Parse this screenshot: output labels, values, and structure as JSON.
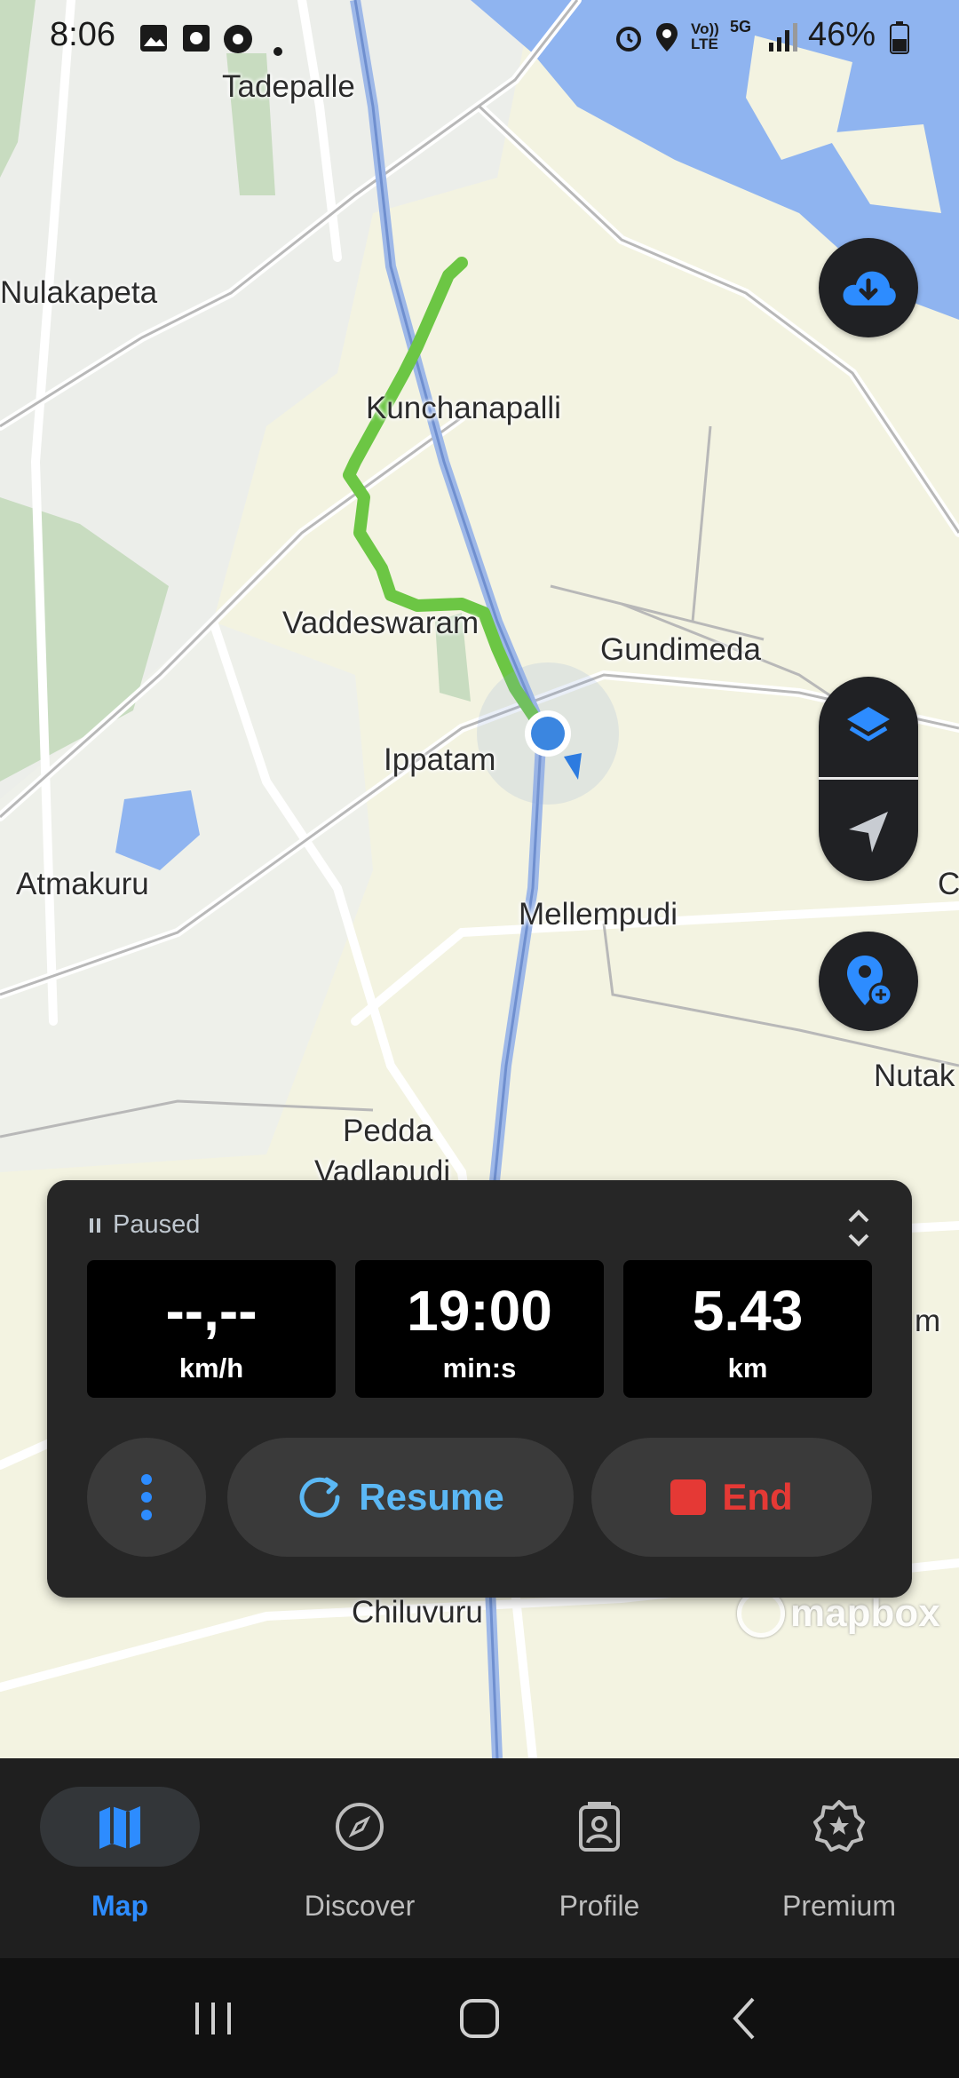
{
  "status_bar": {
    "time": "8:06",
    "battery": "46%",
    "icons": [
      "gallery-icon",
      "photo-icon",
      "chrome-icon",
      "dot-icon",
      "alarm-icon",
      "location-icon",
      "volte-icon",
      "5g-icon",
      "signal-icon",
      "battery-icon"
    ]
  },
  "map": {
    "places": [
      "Tadepalle",
      "Nulakapeta",
      "Kunchanapalli",
      "Vaddeswaram",
      "Gundimeda",
      "Ippatam",
      "Atmakuru",
      "Mellempudi",
      "Nutak",
      "C",
      "Pedda",
      "Vadlapudi",
      "Chiluvuru",
      "m"
    ],
    "attribution": "mapbox",
    "route_color": "#6cc644",
    "water_color": "#8fb4f0"
  },
  "panel": {
    "status": "Paused",
    "stats": [
      {
        "value": "--,--",
        "unit": "km/h"
      },
      {
        "value": "19:00",
        "unit": "min:s"
      },
      {
        "value": "5.43",
        "unit": "km"
      }
    ],
    "resume_label": "Resume",
    "end_label": "End"
  },
  "bottom_nav": {
    "items": [
      {
        "label": "Map",
        "icon": "map-icon",
        "active": true
      },
      {
        "label": "Discover",
        "icon": "compass-icon",
        "active": false
      },
      {
        "label": "Profile",
        "icon": "profile-icon",
        "active": false
      },
      {
        "label": "Premium",
        "icon": "premium-badge-icon",
        "active": false
      }
    ]
  },
  "colors": {
    "accent": "#2d8cff",
    "end": "#e53935",
    "resume": "#5bb8f5"
  }
}
